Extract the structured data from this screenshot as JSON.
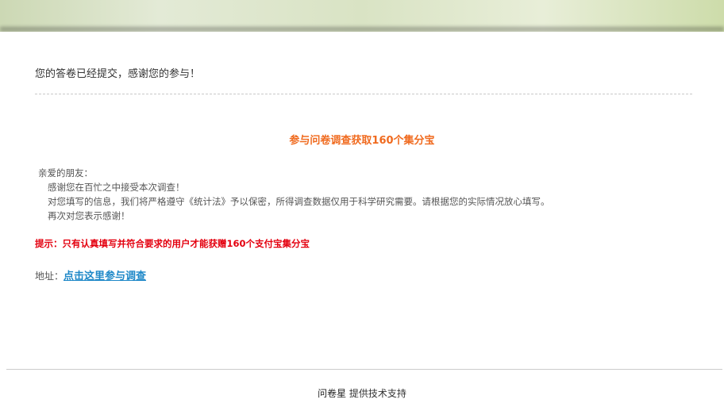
{
  "banner": {
    "colors": [
      "#ccd8b4",
      "#e3ead6",
      "#cddcaa"
    ]
  },
  "message": {
    "submitted": "您的答卷已经提交，感谢您的参与！"
  },
  "promo": {
    "title": "参与问卷调查获取160个集分宝",
    "color": "#f06a1e"
  },
  "letter": {
    "greeting": "亲爱的朋友：",
    "lines": [
      "感谢您在百忙之中接受本次调查！",
      "对您填写的信息，我们将严格遵守《统计法》予以保密，所得调查数据仅用于科学研究需要。请根据您的实际情况放心填写。",
      "再次对您表示感谢！"
    ]
  },
  "tip": {
    "text": "提示：只有认真填写并符合要求的用户才能获赠160个支付宝集分宝",
    "color": "#e4000f"
  },
  "address": {
    "label": "地址：",
    "link_text": "点击这里参与调查",
    "link_color": "#1e88c8"
  },
  "footer": {
    "brand": "问卷星",
    "text": "提供技术支持"
  }
}
